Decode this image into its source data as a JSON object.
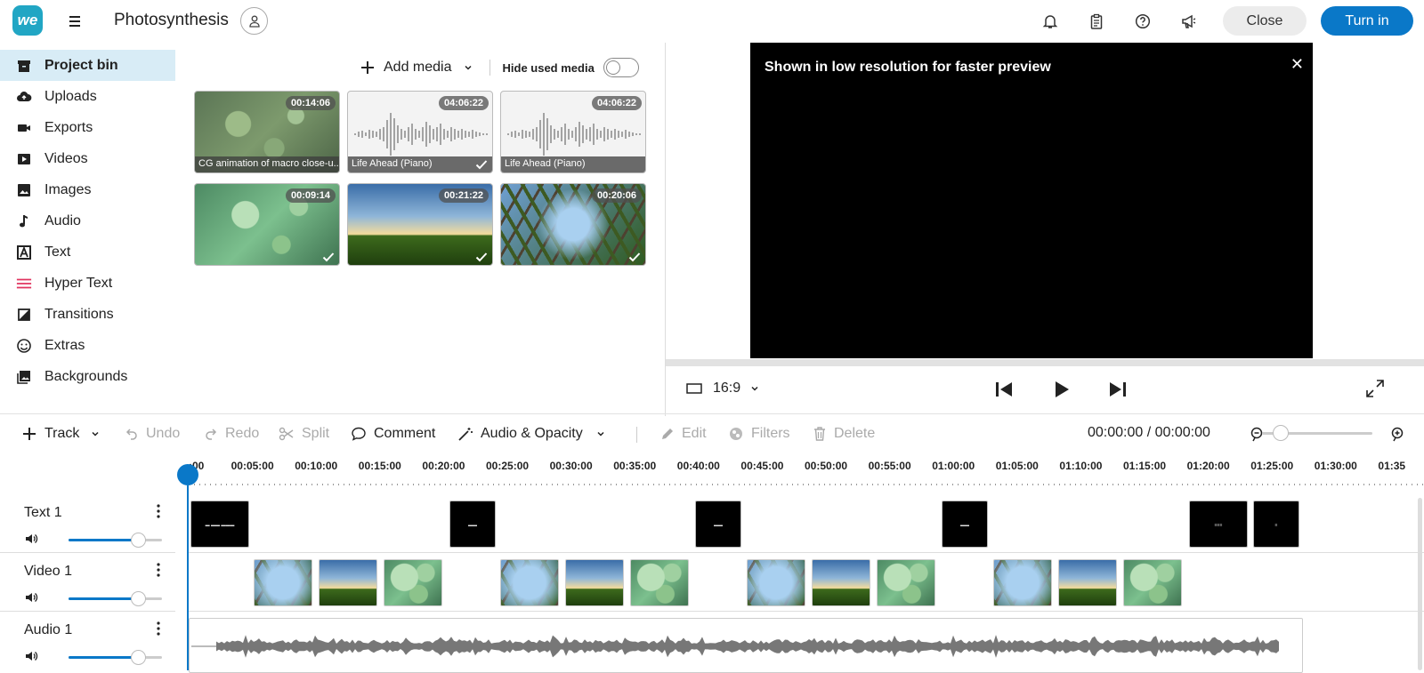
{
  "app": {
    "logo_text": "we",
    "project_title": "Photosynthesis",
    "close_label": "Close",
    "turnin_label": "Turn in"
  },
  "sidebar": {
    "items": [
      {
        "label": "Project bin",
        "icon": "archive-icon",
        "active": true
      },
      {
        "label": "Uploads",
        "icon": "cloud-upload-icon"
      },
      {
        "label": "Exports",
        "icon": "camera-icon"
      },
      {
        "label": "Videos",
        "icon": "video-play-icon"
      },
      {
        "label": "Images",
        "icon": "image-icon"
      },
      {
        "label": "Audio",
        "icon": "music-note-icon"
      },
      {
        "label": "Text",
        "icon": "text-icon"
      },
      {
        "label": "Hyper Text",
        "icon": "hypertext-icon"
      },
      {
        "label": "Transitions",
        "icon": "transition-icon"
      },
      {
        "label": "Extras",
        "icon": "smiley-icon"
      },
      {
        "label": "Backgrounds",
        "icon": "backgrounds-icon"
      }
    ]
  },
  "media": {
    "add_media_label": "Add media",
    "hide_used_label": "Hide used media",
    "hide_used_on": false,
    "items": [
      {
        "duration": "00:14:06",
        "caption": "CG animation of macro close-u...",
        "used": false
      },
      {
        "duration": "04:06:22",
        "caption": "Life Ahead (Piano)",
        "used": true
      },
      {
        "duration": "04:06:22",
        "caption": "Life Ahead (Piano)",
        "used": false
      },
      {
        "duration": "00:09:14",
        "caption": "",
        "used": true
      },
      {
        "duration": "00:21:22",
        "caption": "",
        "used": true
      },
      {
        "duration": "00:20:06",
        "caption": "",
        "used": true
      }
    ]
  },
  "preview": {
    "notice": "Shown in low resolution for faster preview",
    "aspect_ratio": "16:9"
  },
  "toolbar": {
    "track_label": "Track",
    "undo_label": "Undo",
    "redo_label": "Redo",
    "split_label": "Split",
    "comment_label": "Comment",
    "audio_opacity_label": "Audio & Opacity",
    "edit_label": "Edit",
    "filters_label": "Filters",
    "delete_label": "Delete",
    "time_display": "00:00:00 / 00:00:00"
  },
  "ruler": {
    "ticks": [
      ":00",
      "00:05:00",
      "00:10:00",
      "00:15:00",
      "00:20:00",
      "00:25:00",
      "00:30:00",
      "00:35:00",
      "00:40:00",
      "00:45:00",
      "00:50:00",
      "00:55:00",
      "01:00:00",
      "01:05:00",
      "01:10:00",
      "01:15:00",
      "01:20:00",
      "01:25:00",
      "01:30:00",
      "01:35"
    ]
  },
  "tracks": [
    {
      "name": "Text 1",
      "volume": 0.77
    },
    {
      "name": "Video 1",
      "volume": 0.77
    },
    {
      "name": "Audio 1",
      "volume": 0.77
    }
  ],
  "colors": {
    "accent": "#0a78c8",
    "active_bg": "#d8ecf6",
    "logo": "#21a6c4"
  }
}
